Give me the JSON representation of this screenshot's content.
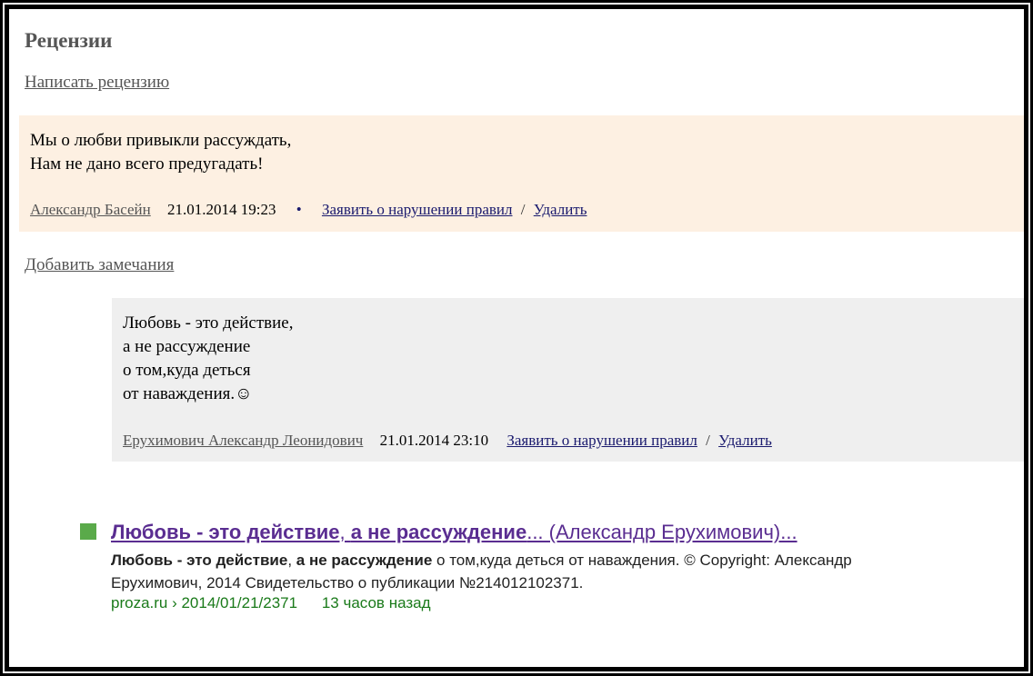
{
  "reviews": {
    "title": "Рецензии",
    "write_review_label": "Написать рецензию",
    "add_remarks_label": "Добавить замечания",
    "items": [
      {
        "lines": [
          "Мы о любви привыкли рассуждать,",
          "Нам не дано всего предугадать!"
        ],
        "author": "Александр Басейн",
        "date": "21.01.2014 19:23",
        "bullet": "•",
        "report_label": "Заявить о нарушении правил",
        "separator": "/",
        "delete_label": "Удалить",
        "background": "#fdf0e2"
      }
    ],
    "comments": [
      {
        "lines": [
          "Любовь - это действие,",
          "а не рассуждение",
          "о том,куда деться",
          "от наваждения.☺"
        ],
        "author": "Ерухимович Александр Леонидович",
        "date": "21.01.2014 23:10",
        "report_label": "Заявить о нарушении правил",
        "separator": "/",
        "delete_label": "Удалить",
        "background": "#efefef"
      }
    ]
  },
  "search_result": {
    "marker_color": "#5aaa4a",
    "title_bold_1": "Любовь - это действие",
    "title_mid": ", ",
    "title_bold_2": "а не рассуждение",
    "title_rest": "... (Александр Ерухимович)...",
    "snippet_bold_1": "Любовь - это действие",
    "snippet_mid": ", ",
    "snippet_bold_2": "а не рассуждение",
    "snippet_rest": " о том,куда деться от наваждения. © Copyright: Александр Ерухимович, 2014 Свидетельство о публикации №214012102371.",
    "url": "proza.ru › 2014/01/21/2371",
    "time_ago": "13 часов назад",
    "link_color": "#5a2d91",
    "url_color": "#1a7a1a"
  }
}
